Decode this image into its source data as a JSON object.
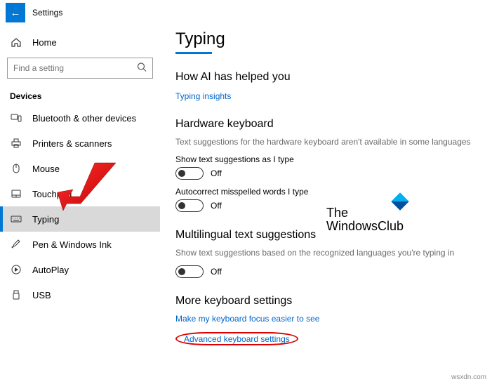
{
  "header": {
    "app_title": "Settings"
  },
  "sidebar": {
    "home": "Home",
    "search_placeholder": "Find a setting",
    "group": "Devices",
    "items": [
      {
        "label": "Bluetooth & other devices"
      },
      {
        "label": "Printers & scanners"
      },
      {
        "label": "Mouse"
      },
      {
        "label": "Touchpad"
      },
      {
        "label": "Typing"
      },
      {
        "label": "Pen & Windows Ink"
      },
      {
        "label": "AutoPlay"
      },
      {
        "label": "USB"
      }
    ]
  },
  "main": {
    "title": "Typing",
    "ai": {
      "heading": "How AI has helped you",
      "link": "Typing insights"
    },
    "hw": {
      "heading": "Hardware keyboard",
      "desc": "Text suggestions for the hardware keyboard aren't available in some languages",
      "opt1_label": "Show text suggestions as I type",
      "opt1_state": "Off",
      "opt2_label": "Autocorrect misspelled words I type",
      "opt2_state": "Off"
    },
    "multi": {
      "heading": "Multilingual text suggestions",
      "desc": "Show text suggestions based on the recognized languages you're typing in",
      "state": "Off"
    },
    "more": {
      "heading": "More keyboard settings",
      "link1": "Make my keyboard focus easier to see",
      "link2": "Advanced keyboard settings"
    }
  },
  "watermark": {
    "line1": "The",
    "line2": "WindowsClub"
  },
  "attribution": "wsxdn.com"
}
